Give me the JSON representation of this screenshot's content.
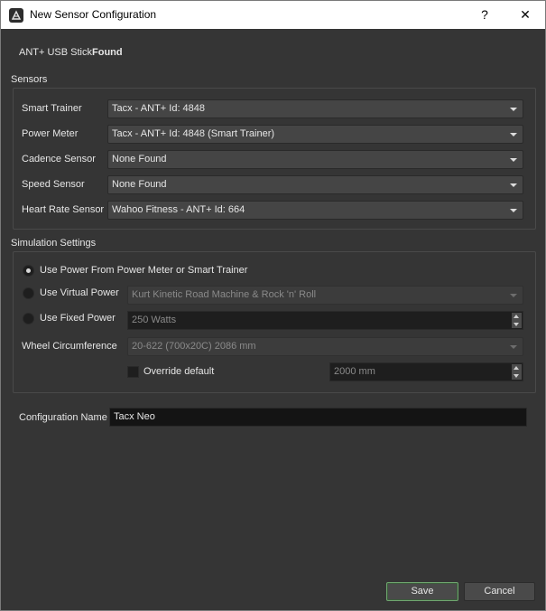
{
  "window": {
    "title": "New Sensor Configuration",
    "help_label": "?",
    "close_label": "✕"
  },
  "ant": {
    "label": "ANT+ USB Stick",
    "status": "Found"
  },
  "sensors": {
    "group_title": "Sensors",
    "rows": [
      {
        "label": "Smart Trainer",
        "value": "Tacx - ANT+ Id: 4848"
      },
      {
        "label": "Power Meter",
        "value": "Tacx - ANT+ Id: 4848 (Smart Trainer)"
      },
      {
        "label": "Cadence Sensor",
        "value": "None Found"
      },
      {
        "label": "Speed Sensor",
        "value": "None Found"
      },
      {
        "label": "Heart Rate Sensor",
        "value": "Wahoo Fitness - ANT+ Id: 664"
      }
    ]
  },
  "simulation": {
    "group_title": "Simulation Settings",
    "use_power_label": "Use Power From Power Meter or Smart Trainer",
    "use_virtual_label": "Use Virtual Power",
    "virtual_value": "Kurt Kinetic Road Machine & Rock 'n' Roll",
    "use_fixed_label": "Use Fixed Power",
    "fixed_value": "250 Watts",
    "wheel_label": "Wheel Circumference",
    "wheel_value": "20-622 (700x20C) 2086 mm",
    "override_label": "Override default",
    "override_value": "2000 mm"
  },
  "config": {
    "label": "Configuration Name",
    "value": "Tacx Neo"
  },
  "buttons": {
    "save": "Save",
    "cancel": "Cancel"
  }
}
